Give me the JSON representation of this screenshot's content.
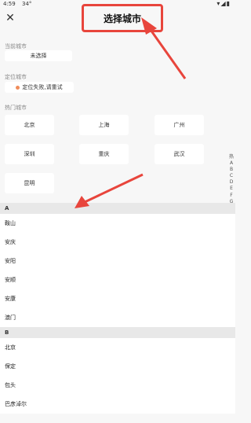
{
  "status": {
    "time": "4:59",
    "temp": "34°",
    "icons": "▾◢▮"
  },
  "header": {
    "title": "选择城市"
  },
  "current": {
    "label": "当前城市",
    "value": "未选择"
  },
  "locate": {
    "label": "定位城市",
    "value": "定位失败,请重试"
  },
  "hot": {
    "label": "热门城市",
    "cities": [
      "北京",
      "上海",
      "广州",
      "深圳",
      "重庆",
      "武汉",
      "昆明"
    ]
  },
  "index": {
    "letters": [
      "热",
      "A",
      "B",
      "C",
      "D",
      "E",
      "F",
      "G",
      "H",
      "J",
      "K",
      "L",
      "M",
      "N",
      "P",
      "Q",
      "R",
      "S",
      "T",
      "W",
      "X",
      "Y",
      "Z"
    ]
  },
  "groups": [
    {
      "letter": "A",
      "cities": [
        "鞍山",
        "安庆",
        "安阳",
        "安顺",
        "安康",
        "澳门"
      ]
    },
    {
      "letter": "B",
      "cities": [
        "北京",
        "保定",
        "包头",
        "巴彦淖尔"
      ]
    }
  ],
  "colors": {
    "accent": "#e8453c"
  }
}
